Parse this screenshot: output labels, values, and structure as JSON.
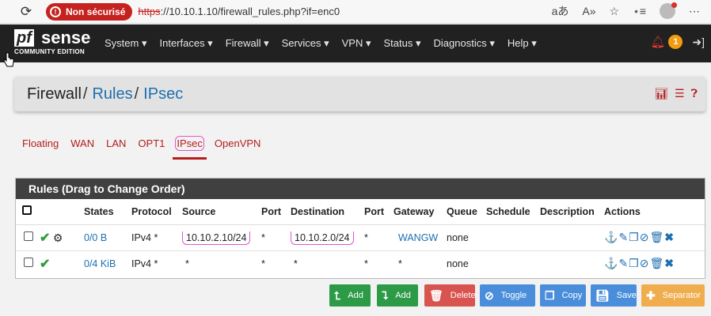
{
  "browser": {
    "security_label": "Non sécurisé",
    "url_scheme": "https",
    "url_rest": "://10.10.1.10/firewall_rules.php?if=enc0"
  },
  "navbar": {
    "logo_pf": "pf",
    "logo_sense": "sense",
    "logo_edition": "COMMUNITY EDITION",
    "menu": [
      "System ▾",
      "Interfaces ▾",
      "Firewall ▾",
      "Services ▾",
      "VPN ▾",
      "Status ▾",
      "Diagnostics ▾",
      "Help ▾"
    ],
    "notification_count": "1"
  },
  "breadcrumb": {
    "part1": "Firewall",
    "part2": "Rules",
    "part3": "IPsec"
  },
  "tabs": [
    "Floating",
    "WAN",
    "LAN",
    "OPT1",
    "IPsec",
    "OpenVPN"
  ],
  "active_tab": "IPsec",
  "panel": {
    "title": "Rules (Drag to Change Order)",
    "columns": [
      "States",
      "Protocol",
      "Source",
      "Port",
      "Destination",
      "Port",
      "Gateway",
      "Queue",
      "Schedule",
      "Description",
      "Actions"
    ],
    "rows": [
      {
        "states": "0/0 B",
        "protocol": "IPv4 *",
        "source": "10.10.2.10/24",
        "sport": "*",
        "destination": "10.10.2.0/24",
        "dport": "*",
        "gateway": "WANGW",
        "queue": "none",
        "schedule": "",
        "description": ""
      },
      {
        "states": "0/4 KiB",
        "protocol": "IPv4 *",
        "source": "*",
        "sport": "*",
        "destination": "*",
        "dport": "*",
        "gateway": "*",
        "queue": "none",
        "schedule": "",
        "description": ""
      }
    ]
  },
  "buttons": {
    "add_top": "Add",
    "add_bottom": "Add",
    "delete": "Delete",
    "toggle": "Toggle",
    "copy": "Copy",
    "save": "Save",
    "separator": "Separator"
  },
  "colors": {
    "navbar_bg": "#212121",
    "link": "#1e6fb0",
    "tab_red": "#b71c1c",
    "success_green": "#2d9a48",
    "danger_red": "#d9534f",
    "info_blue": "#4a8edb",
    "warning_orange": "#f0ad4e"
  }
}
